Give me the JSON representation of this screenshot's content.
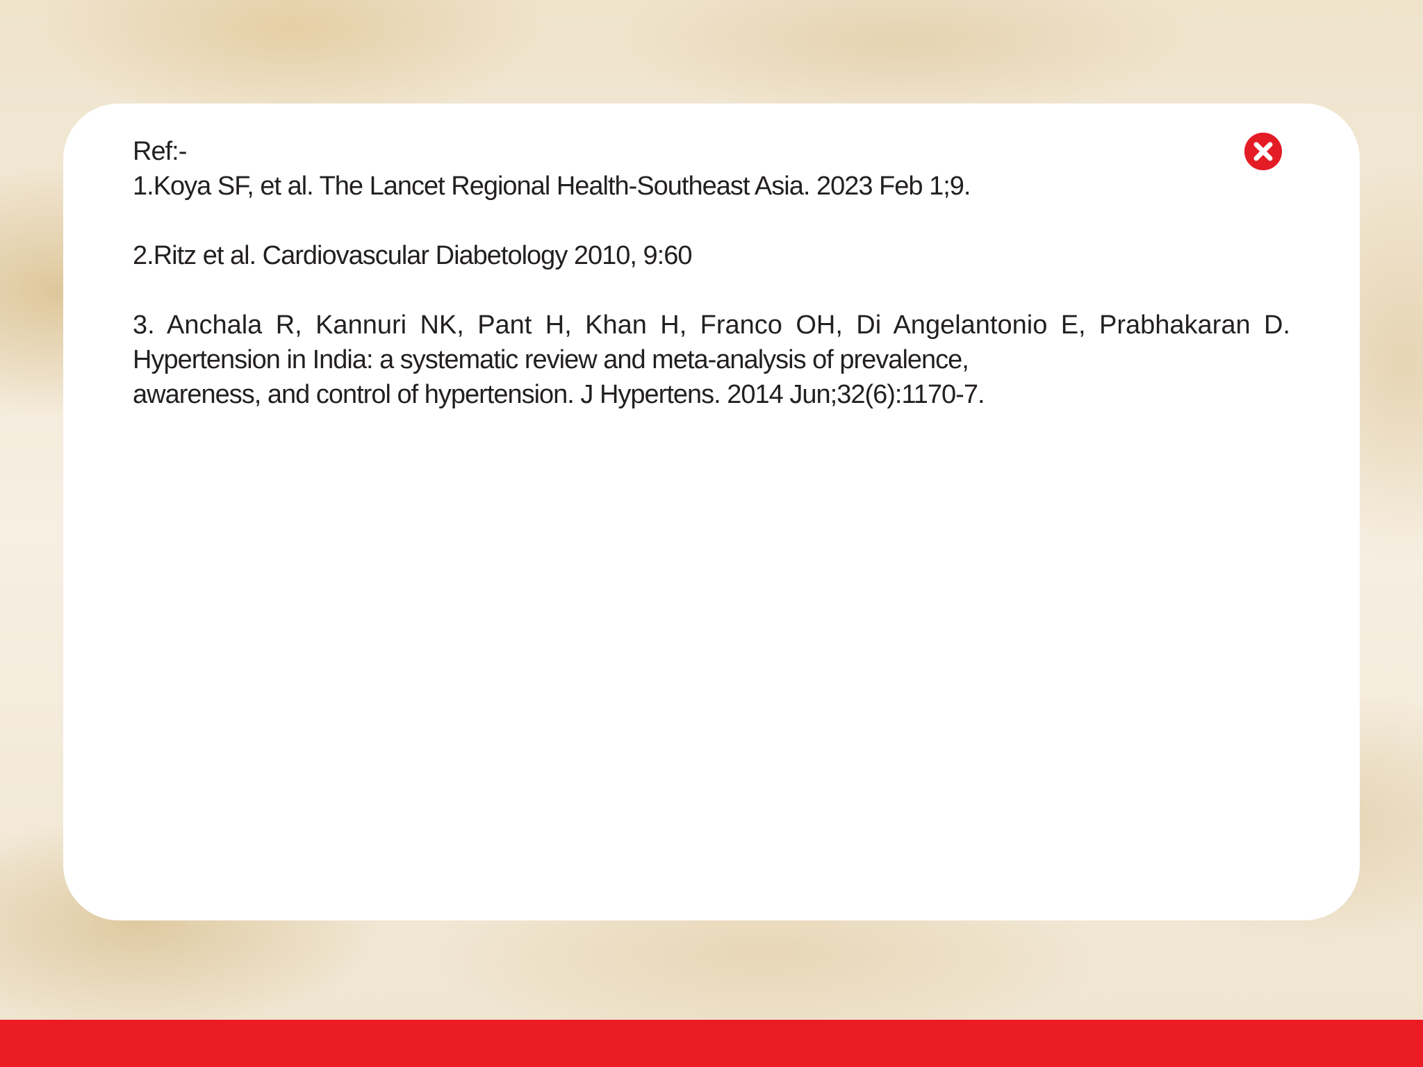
{
  "popup": {
    "heading": "Ref:-",
    "references": [
      "1.Koya SF, et al. The Lancet Regional Health-Southeast Asia. 2023 Feb 1;9.",
      "2.Ritz et al. Cardiovascular Diabetology 2010, 9:60"
    ],
    "reference3": {
      "line1": "3. Anchala R, Kannuri NK, Pant H, Khan H, Franco OH, Di Angelantonio E, Prabhakaran D.",
      "line2": "Hypertension in India: a systematic review and meta-analysis of prevalence,",
      "line3": "awareness, and control of hypertension. J Hypertens. 2014 Jun;32(6):1170-7."
    },
    "close_icon": "close-x-circle-icon"
  },
  "colors": {
    "accent_red": "#ec1c24",
    "close_red": "#e31c26",
    "text": "#231f20",
    "card": "#ffffff",
    "background": "#f3ead8"
  }
}
